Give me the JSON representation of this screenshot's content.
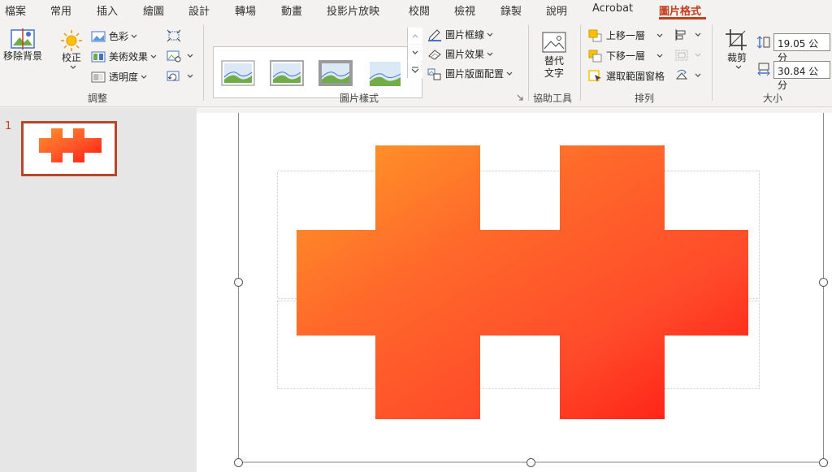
{
  "tabs": [
    {
      "label": "檔案"
    },
    {
      "label": "常用"
    },
    {
      "label": "插入"
    },
    {
      "label": "繪圖"
    },
    {
      "label": "設計"
    },
    {
      "label": "轉場"
    },
    {
      "label": "動畫"
    },
    {
      "label": "投影片放映"
    },
    {
      "label": "校閱"
    },
    {
      "label": "檢視"
    },
    {
      "label": "錄製"
    },
    {
      "label": "說明"
    },
    {
      "label": "Acrobat"
    },
    {
      "label": "圖片格式"
    }
  ],
  "ribbon": {
    "adjust": {
      "remove_bg": "移除背景",
      "corrections": "校正",
      "color": "色彩",
      "artistic": "美術效果",
      "transparency": "透明度",
      "group_label": "調整"
    },
    "styles": {
      "border": "圖片框線",
      "effects": "圖片效果",
      "layout": "圖片版面配置",
      "group_label": "圖片樣式"
    },
    "accessibility": {
      "alt_text": "替代\n文字",
      "group_label": "協助工具"
    },
    "arrange": {
      "bring_forward": "上移一層",
      "send_backward": "下移一層",
      "selection_pane": "選取範圍窗格",
      "group_label": "排列"
    },
    "size": {
      "crop": "裁剪",
      "height": "19.05 公分",
      "width": "30.84 公分",
      "group_label": "大小"
    }
  },
  "slides": [
    {
      "number": "1"
    }
  ],
  "colors": {
    "accent": "#c43e1c",
    "gradient_start": "#ff8f2a",
    "gradient_end": "#ff1a10"
  }
}
